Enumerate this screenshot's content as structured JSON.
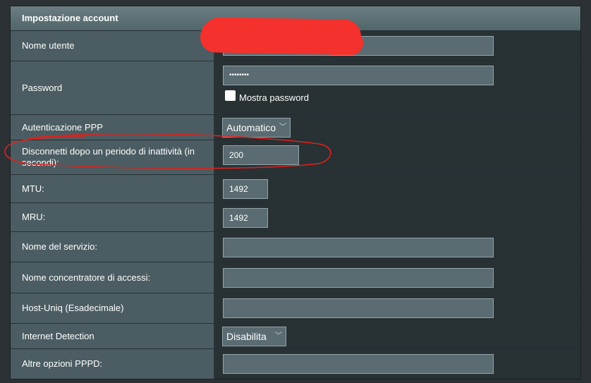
{
  "section": {
    "title": "Impostazione account"
  },
  "rows": {
    "username": {
      "label": "Nome utente",
      "value": ""
    },
    "password": {
      "label": "Password",
      "value": "••••••••",
      "show_label": "Mostra password"
    },
    "ppp_auth": {
      "label": "Autenticazione PPP",
      "selected": "Automatico"
    },
    "idle_disconnect": {
      "label": "Disconnetti dopo un periodo di inattività (in secondi):",
      "value": "200"
    },
    "mtu": {
      "label": "MTU:",
      "value": "1492"
    },
    "mru": {
      "label": "MRU:",
      "value": "1492"
    },
    "service_name": {
      "label": "Nome del servizio:",
      "value": ""
    },
    "access_concentrator": {
      "label": "Nome concentratore di accessi:",
      "value": ""
    },
    "host_uniq": {
      "label": "Host-Uniq (Esadecimale)",
      "value": ""
    },
    "internet_detection": {
      "label": "Internet Detection",
      "selected": "Disabilita"
    },
    "pppd_options": {
      "label": "Altre opzioni PPPD:",
      "value": ""
    }
  },
  "colors": {
    "annotation_red": "#e0211c",
    "redaction_red": "#f4312d"
  },
  "icons": {
    "dropdown": "chevron-down-icon"
  }
}
